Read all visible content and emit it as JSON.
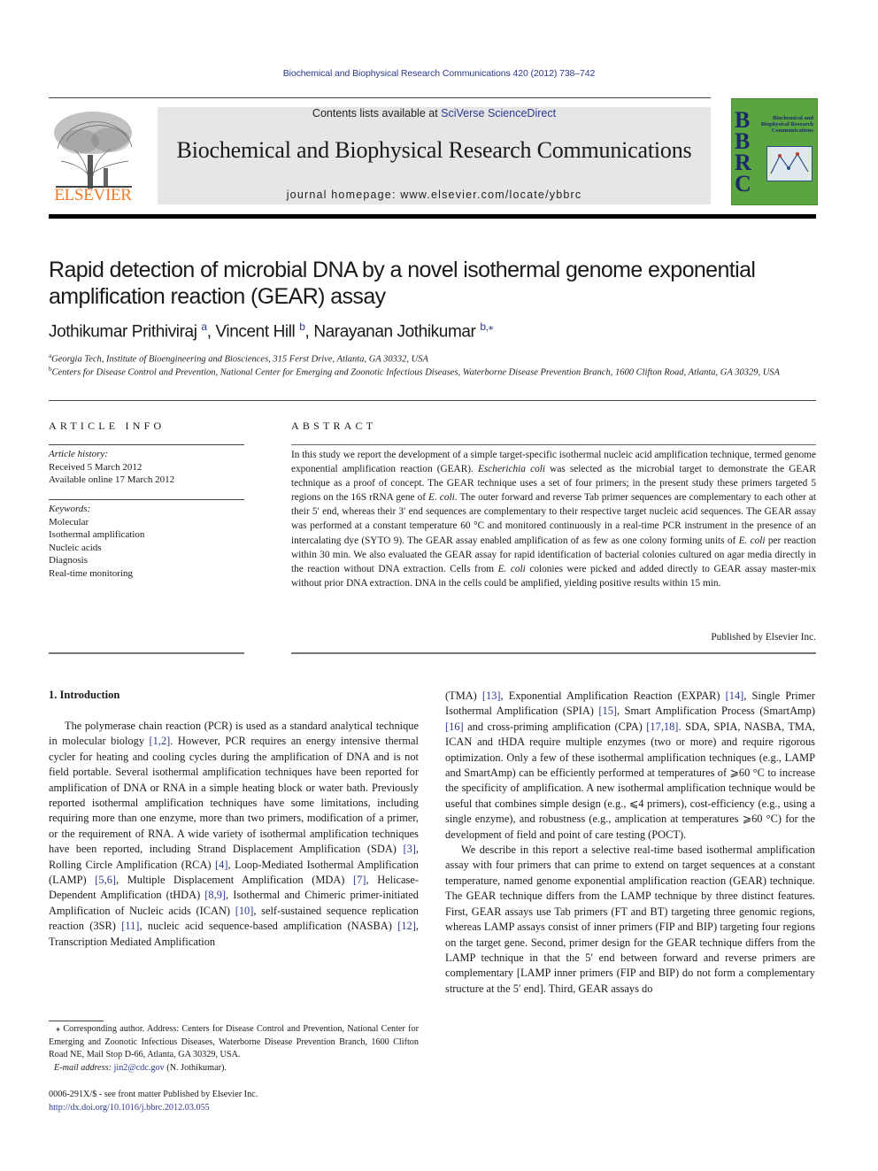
{
  "running_head": "Biochemical and Biophysical Research Communications 420 (2012) 738–742",
  "masthead": {
    "contents_prefix": "Contents lists available at ",
    "contents_link": "SciVerse ScienceDirect",
    "journal_title": "Biochemical and Biophysical Research Communications",
    "homepage": "journal homepage: www.elsevier.com/locate/ybbrc",
    "publisher_logo_text": "ELSEVIER",
    "cover_letters": [
      "B",
      "B",
      "R",
      "C"
    ],
    "cover_text": "Biochemical and Biophysical Research Communications",
    "colors": {
      "elsevier_orange": "#f47920",
      "cover_green": "#5aa540",
      "link_blue": "#2b3990",
      "masthead_gray": "#e6e6e6"
    }
  },
  "article": {
    "title": "Rapid detection of microbial DNA by a novel isothermal genome exponential amplification reaction (GEAR) assay",
    "authors": [
      {
        "name": "Jothikumar Prithiviraj",
        "sup": "a"
      },
      {
        "name": "Vincent Hill",
        "sup": "b"
      },
      {
        "name": "Narayanan Jothikumar",
        "sup": "b,⁎"
      }
    ],
    "affiliations": [
      {
        "sup": "a",
        "text": "Georgia Tech, Institute of Bioengineering and Biosciences, 315 Ferst Drive, Atlanta, GA 30332, USA"
      },
      {
        "sup": "b",
        "text": "Centers for Disease Control and Prevention, National Center for Emerging and Zoonotic Infectious Diseases, Waterborne Disease Prevention Branch, 1600 Clifton Road, Atlanta, GA 30329, USA"
      }
    ]
  },
  "article_info": {
    "heading": "ARTICLE INFO",
    "history_label": "Article history:",
    "received": "Received 5 March 2012",
    "available": "Available online 17 March 2012",
    "keywords_label": "Keywords:",
    "keywords": [
      "Molecular",
      "Isothermal amplification",
      "Nucleic acids",
      "Diagnosis",
      "Real-time monitoring"
    ]
  },
  "abstract": {
    "heading": "ABSTRACT",
    "segments": [
      {
        "t": "In this study we report the development of a simple target-specific isothermal nucleic acid amplification technique, termed genome exponential amplification reaction (GEAR). "
      },
      {
        "t": "Escherichia coli",
        "i": true
      },
      {
        "t": " was selected as the microbial target to demonstrate the GEAR technique as a proof of concept. The GEAR technique uses a set of four primers; in the present study these primers targeted 5 regions on the 16S rRNA gene of "
      },
      {
        "t": "E. coli",
        "i": true
      },
      {
        "t": ". The outer forward and reverse Tab primer sequences are complementary to each other at their 5′ end, whereas their 3′ end sequences are complementary to their respective target nucleic acid sequences. The GEAR assay was performed at a constant temperature 60 °C and monitored continuously in a real-time PCR instrument in the presence of an intercalating dye (SYTO 9). The GEAR assay enabled amplification of as few as one colony forming units of "
      },
      {
        "t": "E. coli",
        "i": true
      },
      {
        "t": " per reaction within 30 min. We also evaluated the GEAR assay for rapid identification of bacterial colonies cultured on agar media directly in the reaction without DNA extraction. Cells from "
      },
      {
        "t": "E. coli",
        "i": true
      },
      {
        "t": " colonies were picked and added directly to GEAR assay master-mix without prior DNA extraction. DNA in the cells could be amplified, yielding positive results within 15 min."
      }
    ],
    "published_by": "Published by Elsevier Inc."
  },
  "introduction": {
    "heading": "1. Introduction",
    "left_column": [
      {
        "t": "The polymerase chain reaction (PCR) is used as a standard analytical technique in molecular biology "
      },
      {
        "t": "[1,2]",
        "ref": true
      },
      {
        "t": ". However, PCR requires an energy intensive thermal cycler for heating and cooling cycles during the amplification of DNA and is not field portable. Several isothermal amplification techniques have been reported for amplification of DNA or RNA in a simple heating block or water bath. Previously reported isothermal amplification techniques have some limitations, including requiring more than one enzyme, more than two primers, modification of a primer, or the requirement of RNA. A wide variety of isothermal amplification techniques have been reported, including Strand Displacement Amplification (SDA) "
      },
      {
        "t": "[3]",
        "ref": true
      },
      {
        "t": ", Rolling Circle Amplification (RCA) "
      },
      {
        "t": "[4]",
        "ref": true
      },
      {
        "t": ", Loop-Mediated Isothermal Amplification (LAMP) "
      },
      {
        "t": "[5,6]",
        "ref": true
      },
      {
        "t": ", Multiple Displacement Amplification (MDA) "
      },
      {
        "t": "[7]",
        "ref": true
      },
      {
        "t": ", Helicase-Dependent Amplification (tHDA) "
      },
      {
        "t": "[8,9]",
        "ref": true
      },
      {
        "t": ", Isothermal and Chimeric primer-initiated Amplification of Nucleic acids (ICAN) "
      },
      {
        "t": "[10]",
        "ref": true
      },
      {
        "t": ", self-sustained sequence replication reaction (3SR) "
      },
      {
        "t": "[11]",
        "ref": true
      },
      {
        "t": ", nucleic acid sequence-based amplification (NASBA) "
      },
      {
        "t": "[12]",
        "ref": true
      },
      {
        "t": ", Transcription Mediated Amplification"
      }
    ],
    "right_column_p1": [
      {
        "t": "(TMA) "
      },
      {
        "t": "[13]",
        "ref": true
      },
      {
        "t": ", Exponential Amplification Reaction (EXPAR) "
      },
      {
        "t": "[14]",
        "ref": true
      },
      {
        "t": ", Single Primer Isothermal Amplification (SPIA) "
      },
      {
        "t": "[15]",
        "ref": true
      },
      {
        "t": ", Smart Amplification Process (SmartAmp) "
      },
      {
        "t": "[16]",
        "ref": true
      },
      {
        "t": " and cross-priming amplification (CPA) "
      },
      {
        "t": "[17,18]",
        "ref": true
      },
      {
        "t": ". SDA, SPIA, NASBA, TMA, ICAN and tHDA require multiple enzymes (two or more) and require rigorous optimization. Only a few of these isothermal amplification techniques (e.g., LAMP and SmartAmp) can be efficiently performed at temperatures of ⩾60 °C to increase the specificity of amplification. A new isothermal amplification technique would be useful that combines simple design (e.g., ⩽4 primers), cost-efficiency (e.g., using a single enzyme), and robustness (e.g., amplication at temperatures ⩾60 °C) for the development of field and point of care testing (POCT)."
      }
    ],
    "right_column_p2": [
      {
        "t": "We describe in this report a selective real-time based isothermal amplification assay with four primers that can prime to extend on target sequences at a constant temperature, named genome exponential amplification reaction (GEAR) technique. The GEAR technique differs from the LAMP technique by three distinct features. First, GEAR assays use Tab primers (FT and BT) targeting three genomic regions, whereas LAMP assays consist of inner primers (FIP and BIP) targeting four regions on the target gene. Second, primer design for the GEAR technique differs from the LAMP technique in that the 5′ end between forward and reverse primers are complementary [LAMP inner primers (FIP and BIP) do not form a complementary structure at the 5′ end]. Third, GEAR assays do"
      }
    ]
  },
  "footnote": {
    "corresponding": "⁎ Corresponding author. Address: Centers for Disease Control and Prevention, National Center for Emerging and Zoonotic Infectious Diseases, Waterborne Disease Prevention Branch, 1600 Clifton Road NE, Mail Stop D-66, Atlanta, GA 30329, USA.",
    "email_label": "E-mail address: ",
    "email": "jin2@cdc.gov",
    "email_suffix": " (N. Jothikumar).",
    "issn_line": "0006-291X/$ - see front matter Published by Elsevier Inc.",
    "doi": "http://dx.doi.org/10.1016/j.bbrc.2012.03.055"
  }
}
